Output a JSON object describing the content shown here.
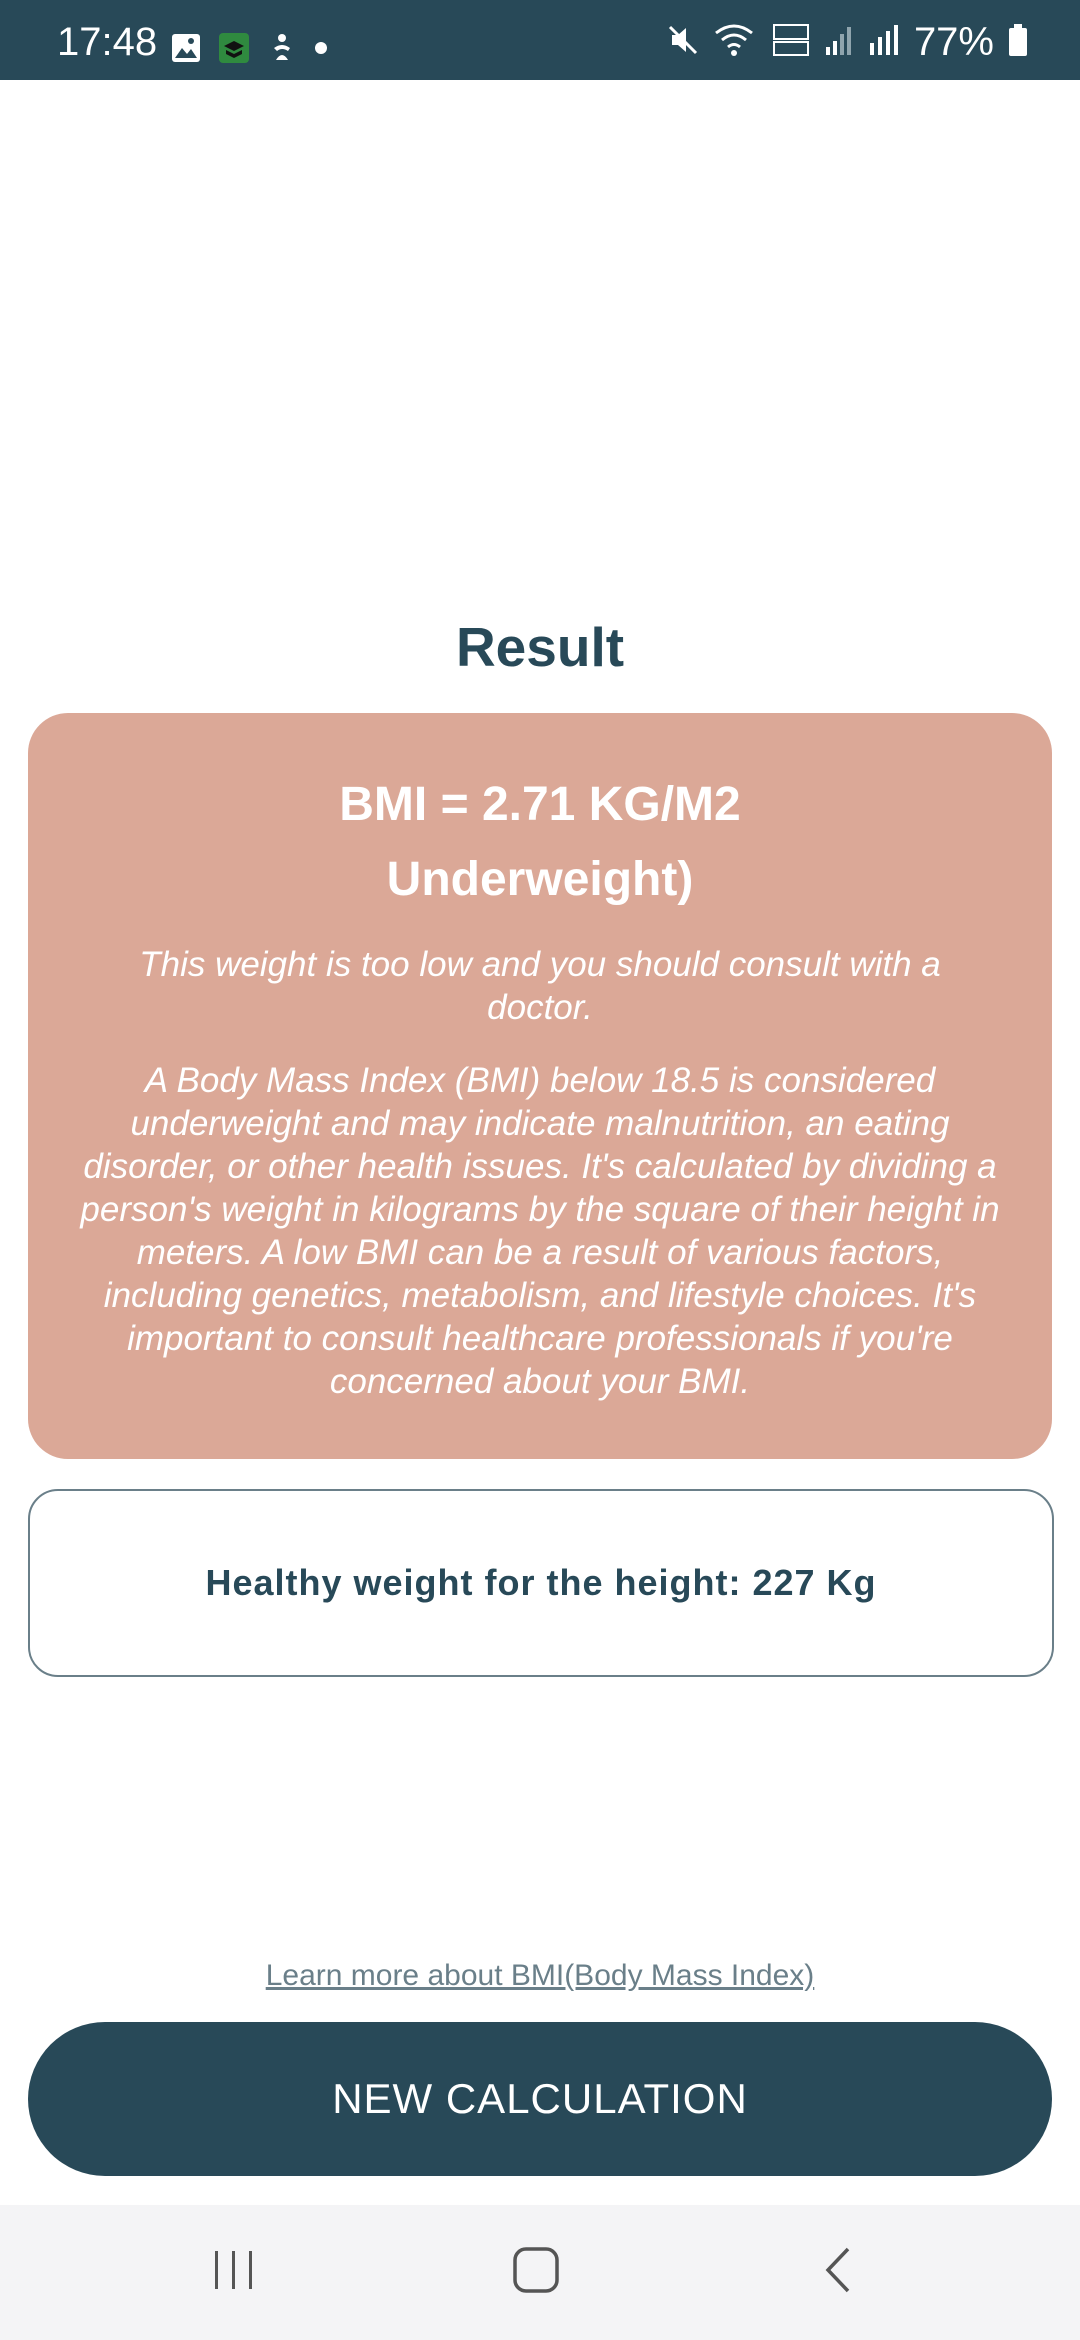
{
  "status_bar": {
    "time": "17:48",
    "battery": "77%",
    "left_icons": [
      "image-icon",
      "app-notification-icon",
      "accessibility-icon",
      "dot-icon"
    ],
    "right_icons": [
      "mute-icon",
      "wifi-icon",
      "volte-icon",
      "signal-icon",
      "signal-roaming-icon",
      "battery-icon"
    ]
  },
  "page": {
    "title": "Result"
  },
  "result": {
    "bmi_line": "BMI = 2.71 KG/M2",
    "category_line": "Underweight)",
    "advice": "This weight is too low and you should consult with a doctor.",
    "info": "A Body Mass Index (BMI) below 18.5 is considered underweight and may indicate malnutrition, an eating disorder, or other health issues. It's calculated by dividing a person's weight in kilograms by the square of their height in meters. A low BMI can be a result of various factors, including genetics, metabolism, and lifestyle choices. It's important to consult healthcare professionals if you're concerned about your BMI.",
    "card_color": "#dba897"
  },
  "healthy": {
    "text": "Healthy weight for the height: 227 Kg"
  },
  "links": {
    "learn_more": "Learn more about BMI(Body Mass Index)"
  },
  "actions": {
    "new_calculation": "NEW CALCULATION"
  },
  "colors": {
    "primary": "#284958",
    "result_card": "#dba897",
    "link": "#6a7f89",
    "navbar_bg": "#f4f4f6"
  },
  "nav_bar": {
    "icons": [
      "recent-apps-icon",
      "home-icon",
      "back-icon"
    ]
  }
}
